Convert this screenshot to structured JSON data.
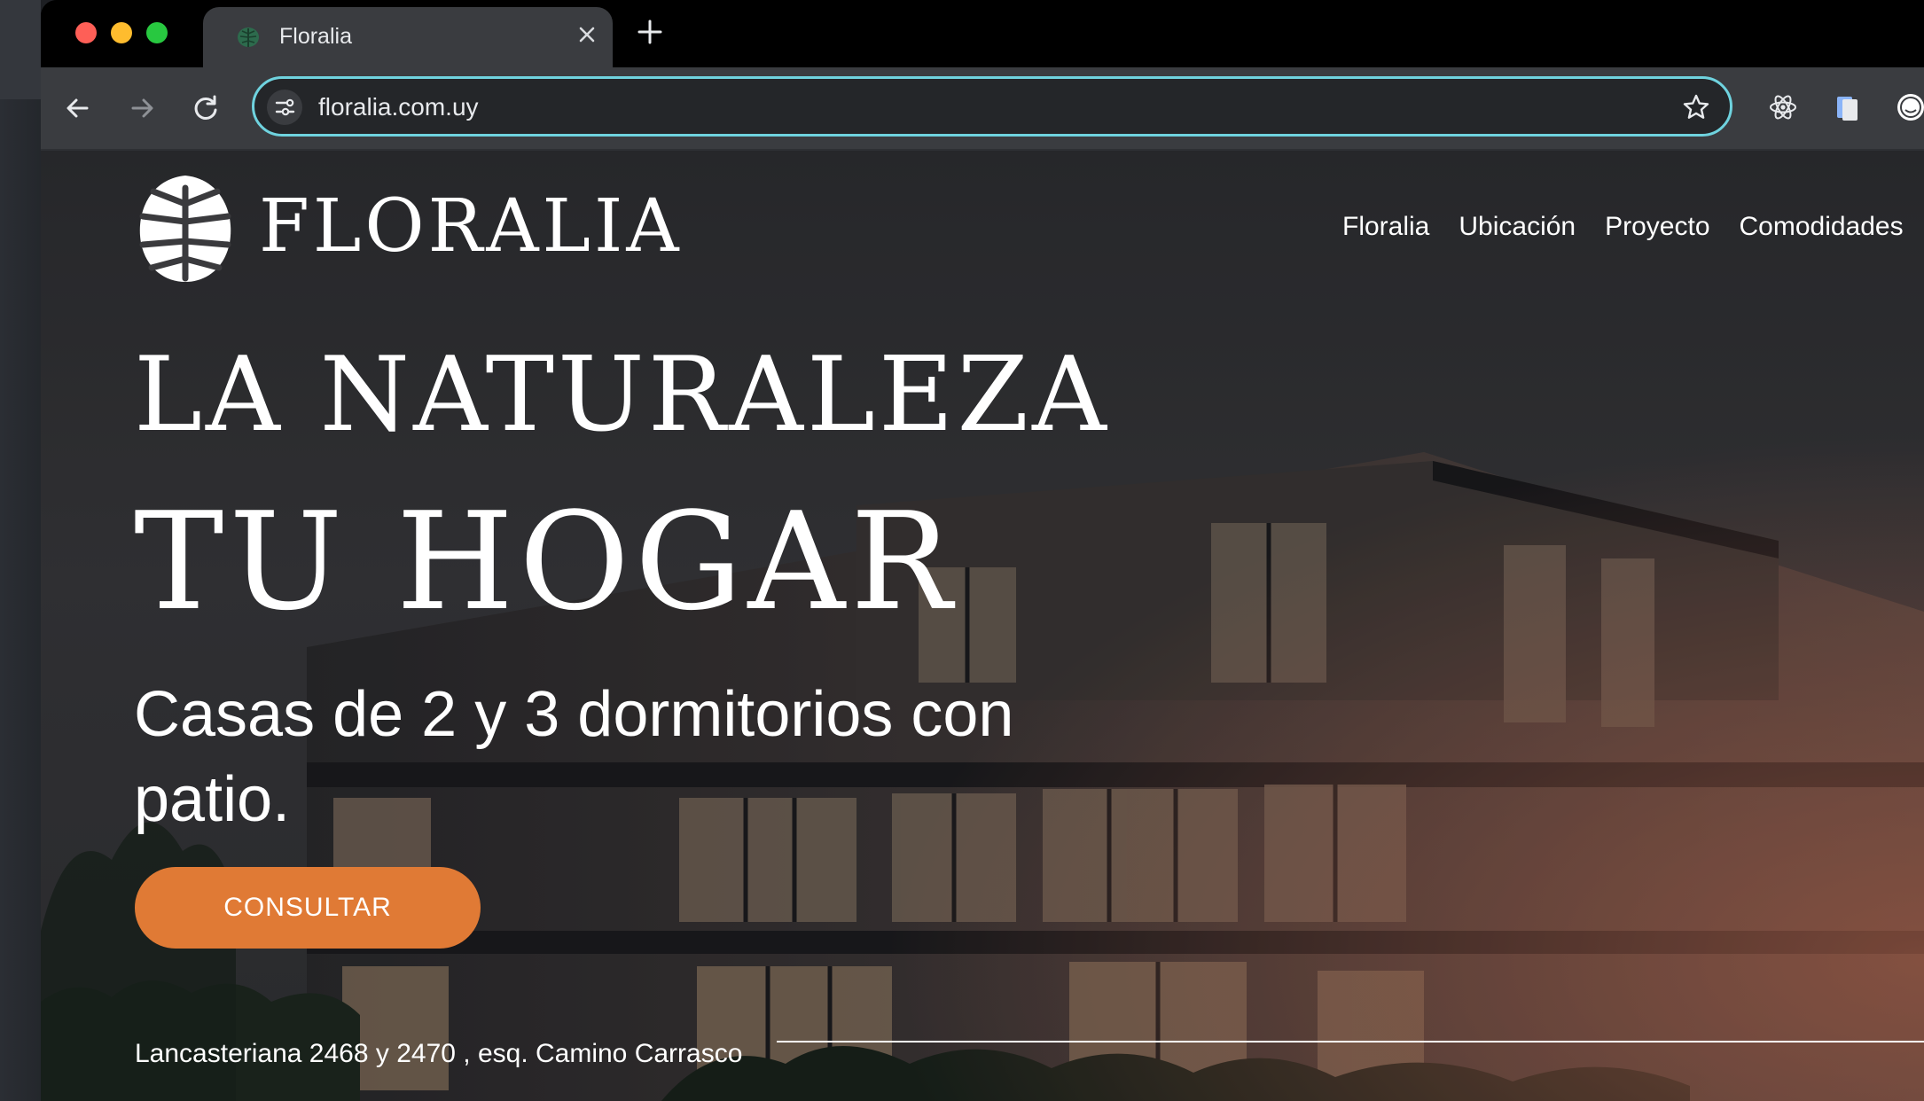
{
  "browser": {
    "tab": {
      "title": "Floralia",
      "favicon": "leaf-favicon-icon",
      "close_icon": "close-icon"
    },
    "new_tab_icon": "plus-icon",
    "toolbar": {
      "back_icon": "arrow-left-icon",
      "forward_icon": "arrow-right-icon",
      "reload_icon": "reload-icon",
      "url": "floralia.com.uy",
      "site_info_icon": "tune-icon",
      "bookmark_icon": "star-icon"
    },
    "extensions": [
      "react-atom-icon",
      "copy-icon",
      "profile-icon"
    ],
    "colors": {
      "omnibox_focus": "#6fd3df",
      "traffic_red": "#fe5f57",
      "traffic_yellow": "#febc2e",
      "traffic_green": "#28c840"
    }
  },
  "site": {
    "brand": "FLORALIA",
    "logo_icon": "monstera-leaf-icon",
    "nav": [
      "Floralia",
      "Ubicación",
      "Proyecto",
      "Comodidades"
    ],
    "hero": {
      "headline_line1": "LA NATURALEZA",
      "headline_line2": "TU HOGAR",
      "subtitle": "Casas de 2 y 3 dormitorios con patio.",
      "cta_label": "CONSULTAR",
      "address": "Lancasteriana 2468 y 2470 , esq. Camino Carrasco"
    },
    "colors": {
      "cta": "#e07a35",
      "text": "#ffffff"
    }
  }
}
